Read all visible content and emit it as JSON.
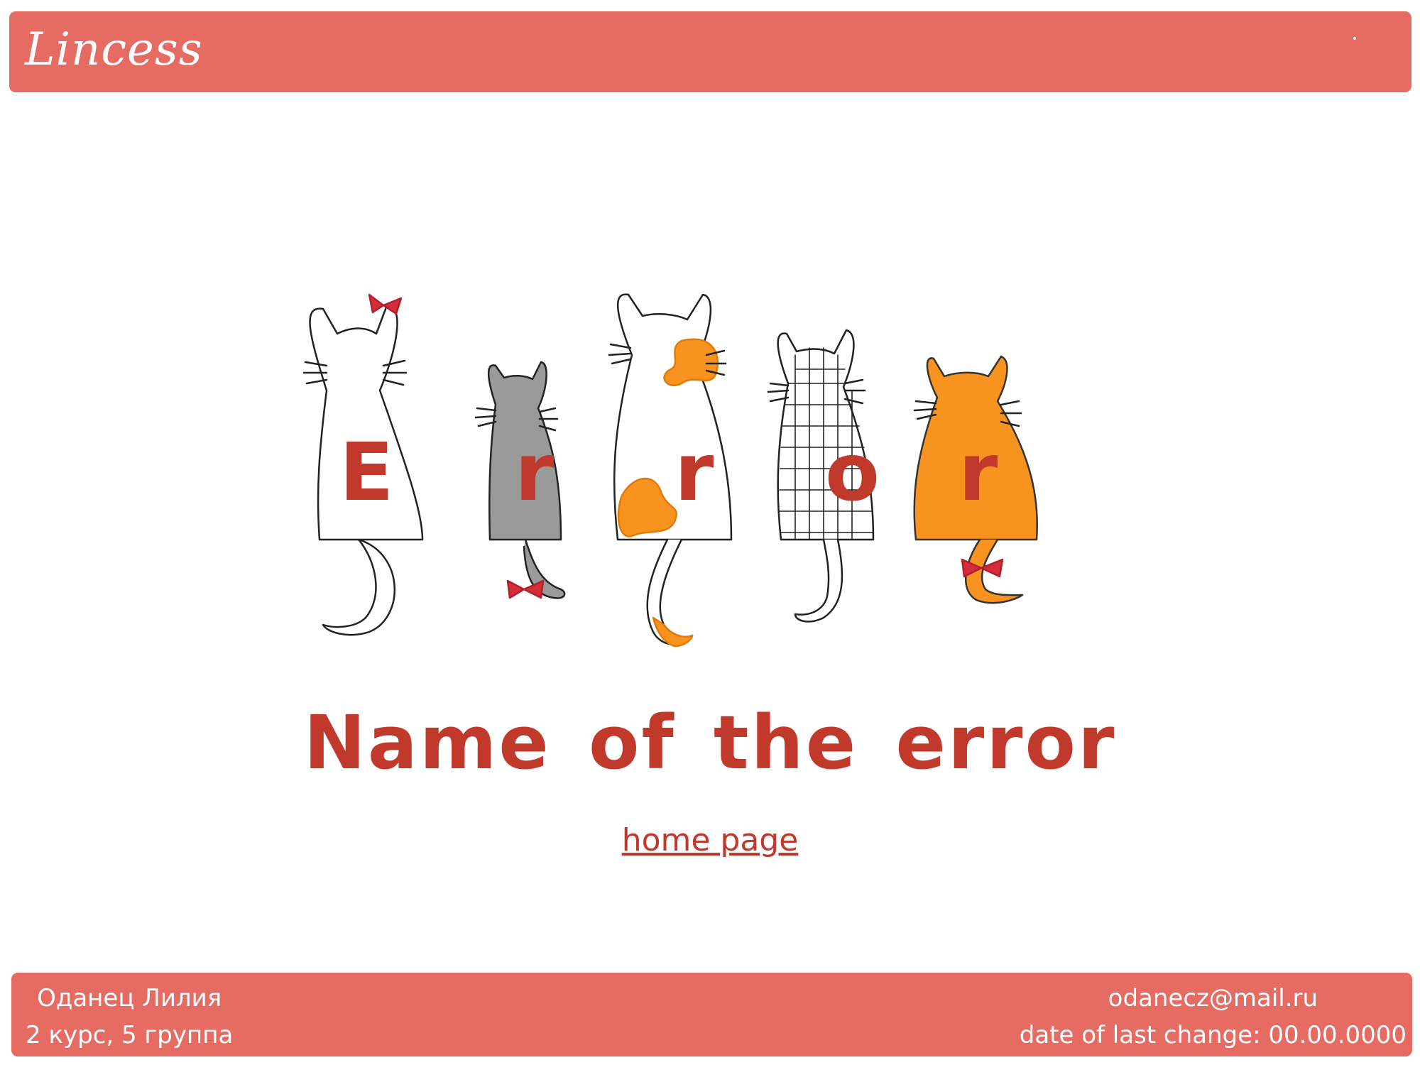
{
  "header": {
    "logo": "Lincess"
  },
  "error": {
    "letters": [
      "E",
      "r",
      "r",
      "o",
      "r"
    ],
    "title": "Name of the error",
    "home_link": "home page"
  },
  "footer": {
    "name": "Оданец Лилия",
    "group": "2 курс, 5 группа",
    "email": "odanecz@mail.ru",
    "last_change": "date of last change: 00.00.0000"
  },
  "colors": {
    "accent": "#e56b63",
    "text_red": "#c0392b",
    "cat_orange": "#f7931e",
    "cat_gray": "#9a9a9a",
    "bow_red": "#d62d3a"
  }
}
